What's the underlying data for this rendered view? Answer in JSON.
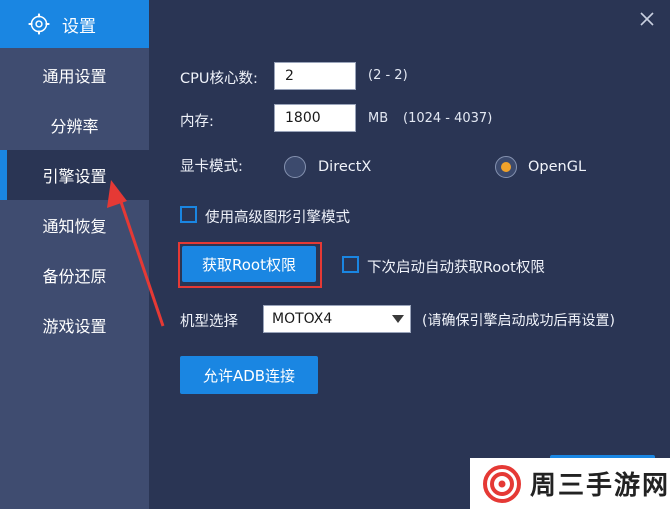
{
  "sidebar": {
    "title": "设置",
    "items": [
      {
        "label": "通用设置",
        "active": false
      },
      {
        "label": "分辨率",
        "active": false
      },
      {
        "label": "引擎设置",
        "active": true
      },
      {
        "label": "通知恢复",
        "active": false
      },
      {
        "label": "备份还原",
        "active": false
      },
      {
        "label": "游戏设置",
        "active": false
      }
    ]
  },
  "engine": {
    "cpu_label": "CPU核心数:",
    "cpu_value": "2",
    "cpu_range": "(2 - 2)",
    "mem_label": "内存:",
    "mem_value": "1800",
    "mem_unit": "MB",
    "mem_range": "(1024 - 4037)",
    "gpu_label": "显卡模式:",
    "gpu_options": [
      {
        "label": "DirectX",
        "selected": false
      },
      {
        "label": "OpenGL",
        "selected": true
      }
    ],
    "advanced_label": "使用高级图形引擎模式",
    "root_button": "获取Root权限",
    "auto_root_label": "下次启动自动获取Root权限",
    "model_label": "机型选择",
    "model_value": "MOTOX4",
    "model_note": "(请确保引擎启动成功后再设置)",
    "adb_button": "允许ADB连接"
  },
  "watermark": {
    "text": "周三手游网"
  },
  "colors": {
    "accent": "#1a86e2",
    "sidebar_bg": "#3f4c70",
    "content_bg": "#2a3554",
    "radio_dot": "#f0a22b",
    "highlight": "#e53935"
  }
}
